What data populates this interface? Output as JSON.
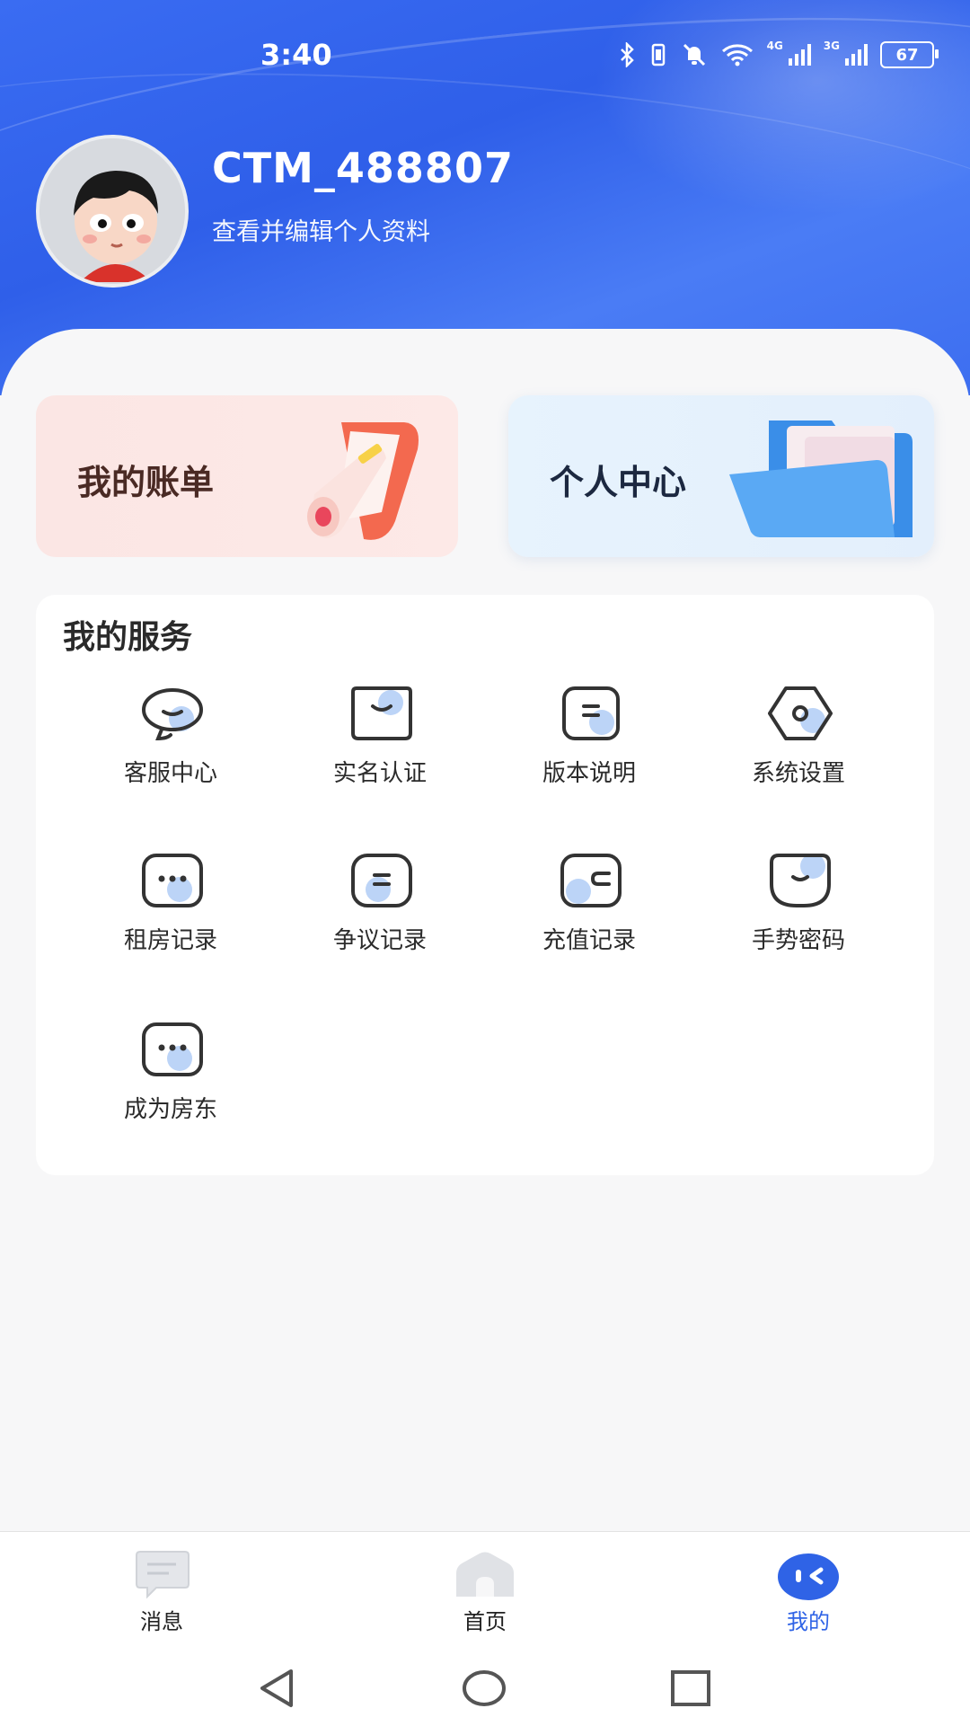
{
  "status_bar": {
    "time": "3:40",
    "battery": "67",
    "network_4g": "4G",
    "network_3g": "3G"
  },
  "profile": {
    "username": "CTM_488807",
    "edit_link": "查看并编辑个人资料"
  },
  "quick_cards": {
    "bill_label": "我的账单",
    "personal_center_label": "个人中心"
  },
  "services": {
    "title": "我的服务",
    "items": [
      {
        "label": "客服中心",
        "icon": "chat-bubble-icon"
      },
      {
        "label": "实名认证",
        "icon": "id-card-icon"
      },
      {
        "label": "版本说明",
        "icon": "document-icon"
      },
      {
        "label": "系统设置",
        "icon": "settings-hexagon-icon"
      },
      {
        "label": "租房记录",
        "icon": "more-dots-icon"
      },
      {
        "label": "争议记录",
        "icon": "document-icon"
      },
      {
        "label": "充值记录",
        "icon": "wallet-icon"
      },
      {
        "label": "手势密码",
        "icon": "smile-icon"
      },
      {
        "label": "成为房东",
        "icon": "more-dots-icon"
      }
    ]
  },
  "tab_bar": {
    "tabs": [
      {
        "label": "消息",
        "icon": "message-icon",
        "active": false
      },
      {
        "label": "首页",
        "icon": "home-icon",
        "active": false
      },
      {
        "label": "我的",
        "icon": "profile-face-icon",
        "active": true
      }
    ]
  },
  "colors": {
    "header_blue": "#3a6cf2",
    "active_tab": "#2f63e6",
    "bill_card": "#fbe6e4",
    "profile_card": "#e7f3fd",
    "icon_accent": "#bcd4f7"
  }
}
